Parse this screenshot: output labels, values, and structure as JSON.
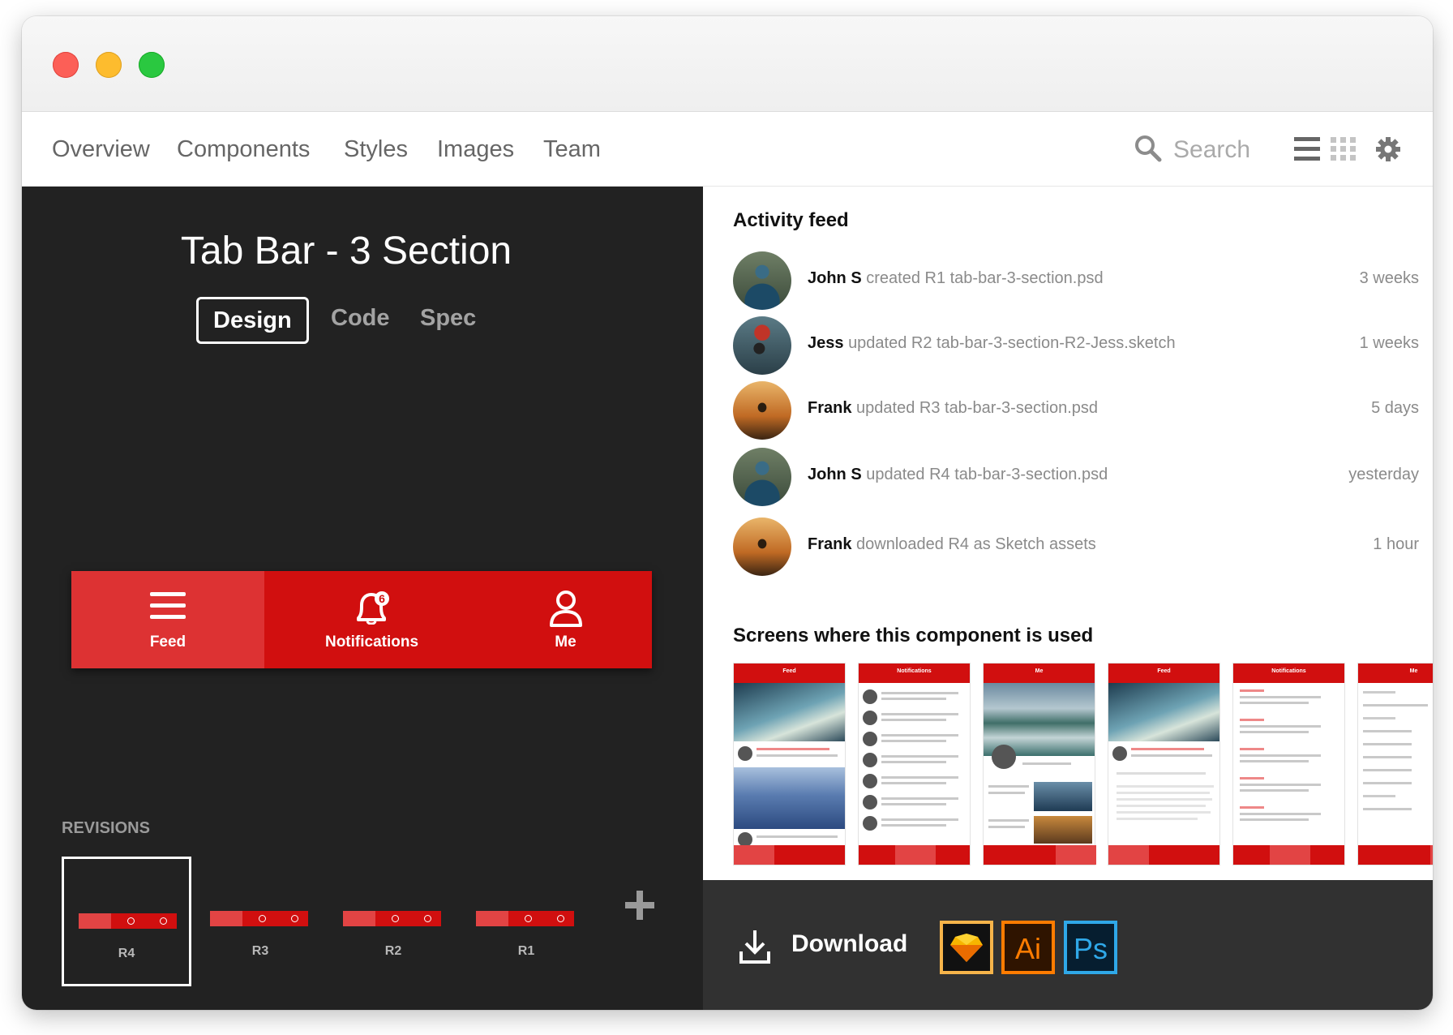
{
  "nav": {
    "items": [
      "Overview",
      "Components",
      "Styles",
      "Images",
      "Team"
    ],
    "search_placeholder": "Search"
  },
  "component": {
    "title": "Tab Bar - 3 Section",
    "tabs": [
      "Design",
      "Code",
      "Spec"
    ],
    "active_tab": "Design"
  },
  "tab_bar": {
    "items": [
      {
        "label": "Feed",
        "icon": "menu-icon"
      },
      {
        "label": "Notifications",
        "icon": "bell-icon",
        "badge": "6"
      },
      {
        "label": "Me",
        "icon": "user-icon"
      }
    ],
    "color": "#d10f0f",
    "active_color": "#dd3233"
  },
  "revisions": {
    "label": "REVISIONS",
    "items": [
      "R4",
      "R3",
      "R2",
      "R1"
    ],
    "active": "R4"
  },
  "activity": {
    "title": "Activity feed",
    "entries": [
      {
        "user": "John S",
        "action": "created R1 tab-bar-3-section.psd",
        "time": "3 weeks"
      },
      {
        "user": "Jess",
        "action": "updated R2 tab-bar-3-section-R2-Jess.sketch",
        "time": "1 weeks"
      },
      {
        "user": "Frank",
        "action": "updated R3 tab-bar-3-section.psd",
        "time": "5 days"
      },
      {
        "user": "John S",
        "action": "updated R4 tab-bar-3-section.psd",
        "time": "yesterday"
      },
      {
        "user": "Frank",
        "action": "downloaded R4 as Sketch assets",
        "time": "1 hour"
      }
    ]
  },
  "screens": {
    "title": "Screens where this component is used",
    "items": [
      "Feed",
      "Notifications",
      "Me",
      "Feed",
      "Notifications",
      "Me"
    ]
  },
  "download": {
    "label": "Download",
    "apps": [
      "Sketch",
      "Ai",
      "Ps"
    ]
  }
}
